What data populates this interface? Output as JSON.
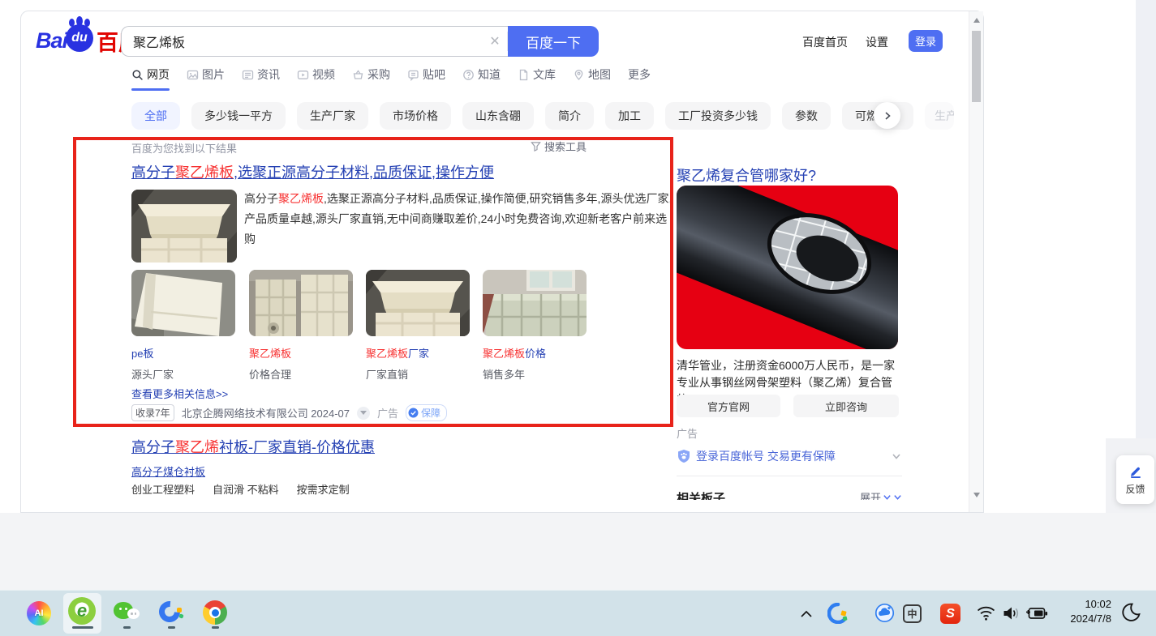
{
  "header": {
    "logo": {
      "bai": "Bai",
      "du": "du",
      "cn": "百度"
    },
    "search": {
      "value": "聚乙烯板",
      "clear": "✕",
      "button": "百度一下"
    },
    "links": {
      "home": "百度首页",
      "settings": "设置",
      "login": "登录"
    }
  },
  "nav": {
    "items": [
      "网页",
      "图片",
      "资讯",
      "视频",
      "采购",
      "贴吧",
      "知道",
      "文库",
      "地图",
      "更多"
    ]
  },
  "chips": {
    "items": [
      "全部",
      "多少钱一平方",
      "生产厂家",
      "市场价格",
      "山东含硼",
      "简介",
      "加工",
      "工厂投资多少钱",
      "参数",
      "可燃烧吗"
    ],
    "partial": "生产"
  },
  "resultsbar": {
    "found": "百度为您找到以下结果",
    "tools": "搜索工具"
  },
  "result1": {
    "title": {
      "p1": "高分子",
      "em": "聚乙烯板",
      "p2": ",选聚正源高分子材料,品质保证,操作方便"
    },
    "desc": {
      "p1": "高分子",
      "em": "聚乙烯板",
      "p2": ",选聚正源高分子材料,品质保证,操作简便,研究销售多年,源头优选厂家,产品质量卓越,源头厂家直销,无中间商赚取差价,24小时免费咨询,欢迎新老客户前来选购"
    },
    "cards": [
      {
        "em": "",
        "rest": "pe板",
        "sub": "源头厂家"
      },
      {
        "em": "聚乙烯板",
        "rest": "",
        "sub": "价格合理"
      },
      {
        "em": "聚乙烯板",
        "rest": "厂家",
        "sub": "厂家直销"
      },
      {
        "em": "聚乙烯板",
        "rest": "价格",
        "sub": "销售多年"
      }
    ],
    "more": "查看更多相关信息>>",
    "meta": {
      "badge": "收录7年",
      "source": "北京企腾网络技术有限公司 2024-07",
      "ad": "广告",
      "guarantee": "保障"
    }
  },
  "result2": {
    "title": {
      "p1": "高分子",
      "em": "聚乙烯",
      "p2": "衬板-厂家直销-价格优惠"
    },
    "sublink": "高分子煤仓衬板",
    "tags": [
      "创业工程塑料",
      "自润滑 不粘料",
      "按需求定制"
    ]
  },
  "sidebar": {
    "title": "聚乙烯复合管哪家好?",
    "desc": "清华管业，注册资金6000万人民币，是一家专业从事钢丝网骨架塑料（聚乙烯）复合管的...",
    "btn_site": "官方官网",
    "btn_consult": "立即咨询",
    "ad": "广告",
    "login": "登录百度帐号 交易更有保障",
    "related": "相关板子",
    "expand": "展开"
  },
  "feedback": {
    "label": "反馈"
  },
  "taskbar": {
    "ai": "AI",
    "browser": "e",
    "ime": "中",
    "sogou": "S",
    "time": "10:02",
    "date": "2024/7/8"
  },
  "colors": {
    "accent": "#4e6ef2",
    "link_blue": "#2440b3",
    "highlight_red": "#f73131",
    "annotation_red": "#e8231a",
    "ad_image_bg": "#e60012",
    "taskbar_bg": "#d2e2e9"
  }
}
